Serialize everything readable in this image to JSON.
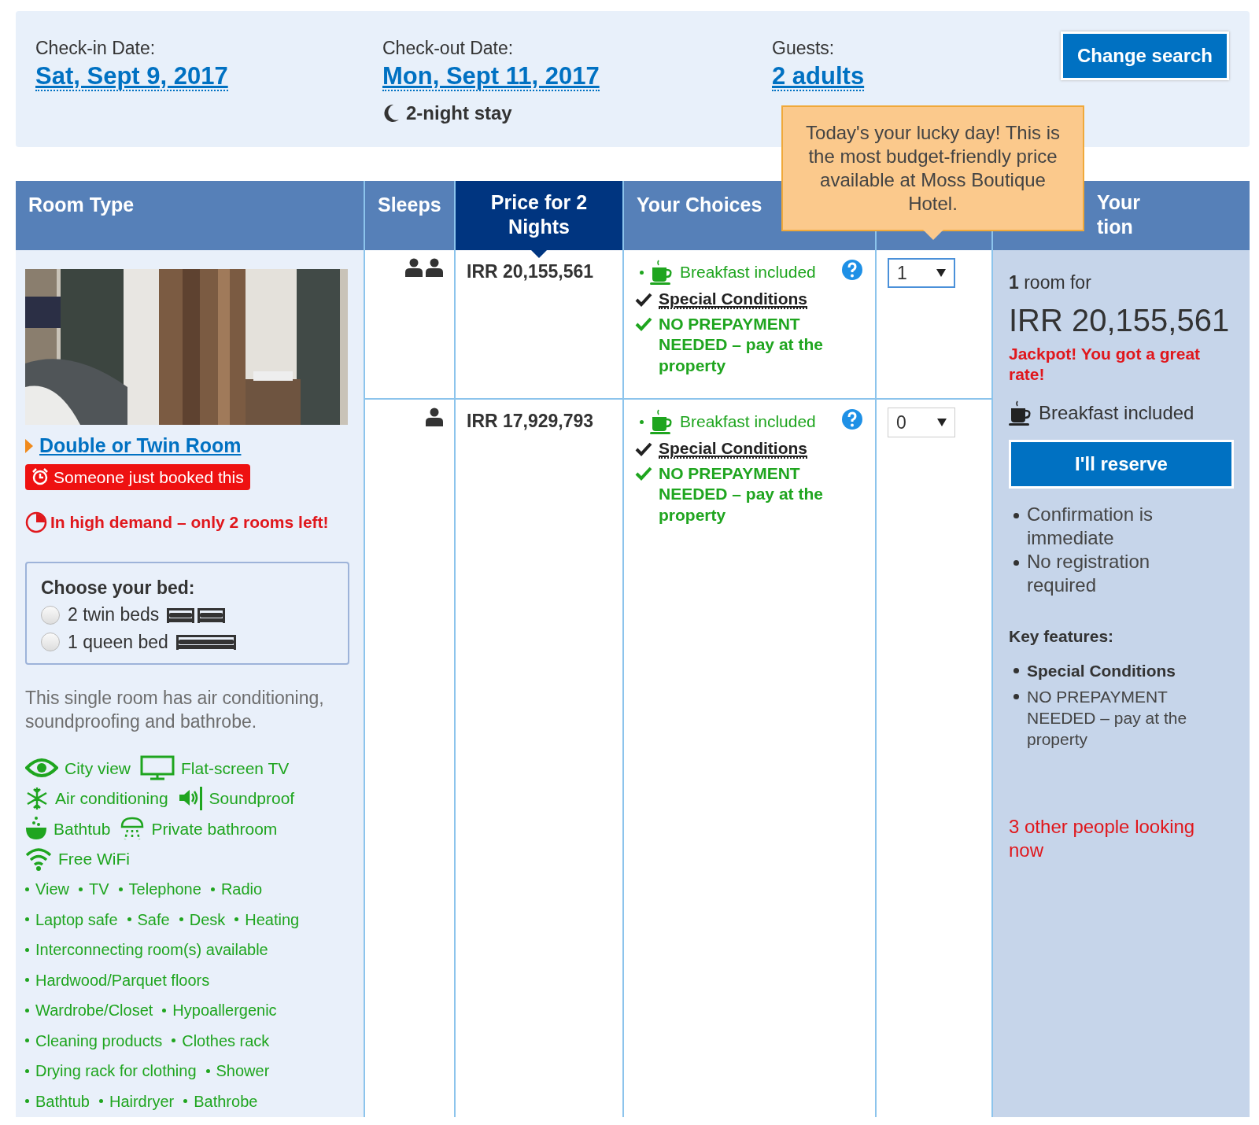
{
  "search": {
    "checkin_label": "Check-in Date:",
    "checkin": "Sat, Sept 9, 2017",
    "checkout_label": "Check-out Date:",
    "checkout": "Mon, Sept 11, 2017",
    "stay": "2-night stay",
    "guests_label": "Guests:",
    "guests": "2 adults",
    "button": "Change search"
  },
  "tooltip": "Today's your lucky day! This is the most budget-friendly price available at Moss Boutique Hotel.",
  "table": {
    "columns": [
      {
        "kind": "text",
        "label": "Room Type",
        "sorted": false
      },
      {
        "kind": "text",
        "label": "Sleeps",
        "sorted": false
      },
      {
        "kind": "text",
        "label": "Price for 2 Nights",
        "sorted": true
      },
      {
        "kind": "text",
        "label": "Your Choices",
        "sorted": false
      },
      {
        "kind": "covered"
      },
      {
        "kind": "partial",
        "lines": [
          "Your",
          "tion"
        ]
      }
    ]
  },
  "room": {
    "name": "Double or Twin Room",
    "badge": "Someone just booked this",
    "demand": "In high demand – only 2 rooms left!",
    "bed_title": "Choose your bed:",
    "beds": [
      {
        "kind": "twin",
        "label": "2 twin beds",
        "selected": false
      },
      {
        "kind": "queen",
        "label": "1 queen bed",
        "selected": false
      }
    ],
    "description": "This single room has air conditioning, soundproofing and bathrobe.",
    "facility_rows": [
      [
        {
          "kind": "view",
          "label": "City view"
        },
        {
          "kind": "tv",
          "label": "Flat-screen TV"
        }
      ],
      [
        {
          "kind": "aircon",
          "label": "Air conditioning"
        },
        {
          "kind": "soundproof",
          "label": "Soundproof"
        }
      ],
      [
        {
          "kind": "bathtub",
          "label": "Bathtub"
        },
        {
          "kind": "bathroom",
          "label": "Private bathroom"
        }
      ],
      [
        {
          "kind": "wifi",
          "label": "Free WiFi"
        }
      ]
    ],
    "amenity_rows": [
      [
        "View",
        "TV",
        "Telephone",
        "Radio"
      ],
      [
        "Laptop safe",
        "Safe",
        "Desk",
        "Heating"
      ],
      [
        "Interconnecting room(s) available"
      ],
      [
        "Hardwood/Parquet floors"
      ],
      [
        "Wardrobe/Closet",
        "Hypoallergenic"
      ],
      [
        "Cleaning products",
        "Clothes rack"
      ],
      [
        "Drying rack for clothing",
        "Shower"
      ],
      [
        "Bathtub",
        "Hairdryer",
        "Bathrobe"
      ]
    ]
  },
  "options": [
    {
      "kind": "double",
      "price": "IRR 20,155,561",
      "quantity": "1",
      "focused": true,
      "choices": [
        {
          "kind": "breakfast",
          "label": "Breakfast included"
        },
        {
          "kind": "conditions",
          "label": "Special Conditions"
        },
        {
          "kind": "prepayment",
          "label": "NO PREPAYMENT NEEDED – pay at the property"
        }
      ]
    },
    {
      "kind": "single",
      "price": "IRR 17,929,793",
      "quantity": "0",
      "focused": false,
      "choices": [
        {
          "kind": "breakfast",
          "label": "Breakfast included"
        },
        {
          "kind": "conditions",
          "label": "Special Conditions"
        },
        {
          "kind": "prepayment",
          "label": "NO PREPAYMENT NEEDED – pay at the property"
        }
      ]
    }
  ],
  "reservation": {
    "summary": "**1** room for",
    "total": "IRR 20,155,561",
    "promo": "Jackpot! You got a great rate!",
    "breakfast": "Breakfast included",
    "button": "I'll reserve",
    "benefits": [
      "Confirmation is immediate",
      "No registration required"
    ],
    "features_title": "Key features:",
    "features": [
      {
        "label": "Special Conditions",
        "bold": true
      },
      {
        "label": "NO PREPAYMENT NEEDED – pay at the property",
        "bold": false
      }
    ],
    "watchers": "3 other people looking now"
  }
}
